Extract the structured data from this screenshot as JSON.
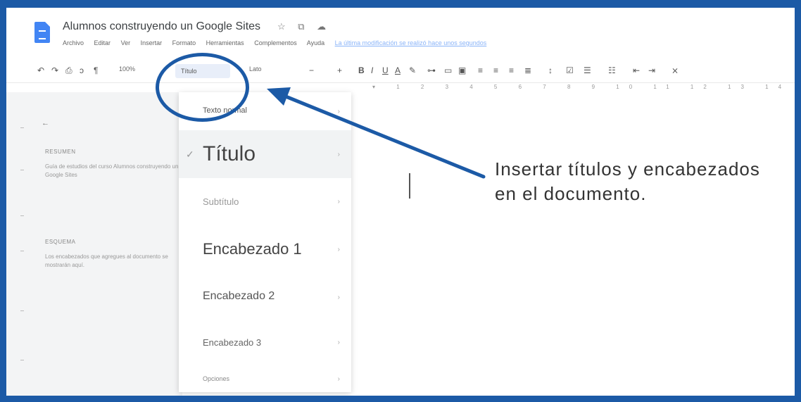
{
  "doc": {
    "title": "Alumnos construyendo un Google Sites",
    "title_icons": "☆ ⧉ ☁"
  },
  "menu": {
    "items": [
      "Archivo",
      "Editar",
      "Ver",
      "Insertar",
      "Formato",
      "Herramientas",
      "Complementos",
      "Ayuda"
    ],
    "last_edit": "La última modificación se realizó hace unos segundos"
  },
  "toolbar": {
    "zoom": "100%",
    "style_value": "Título",
    "font_value": "Lato"
  },
  "outline": {
    "back_icon": "←",
    "summary_label": "RESUMEN",
    "summary_text": "Guía de estudios del curso Alumnos construyendo un Google Sites",
    "outline_label": "ESQUEMA",
    "outline_text": "Los encabezados que agregues al documento se mostrarán aquí."
  },
  "dropdown": {
    "items": [
      {
        "label": "Texto normal",
        "chevron": "›"
      },
      {
        "label": "Título",
        "chevron": "›",
        "check": "✓"
      },
      {
        "label": "Subtítulo",
        "chevron": "›"
      },
      {
        "label": "Encabezado 1",
        "chevron": "›"
      },
      {
        "label": "Encabezado 2",
        "chevron": "›"
      },
      {
        "label": "Encabezado 3",
        "chevron": "›"
      },
      {
        "label": "Opciones",
        "chevron": "›"
      }
    ]
  },
  "annotation": {
    "text": "Insertar títulos y encabezados en el documento.",
    "color": "#1c5aa6"
  }
}
